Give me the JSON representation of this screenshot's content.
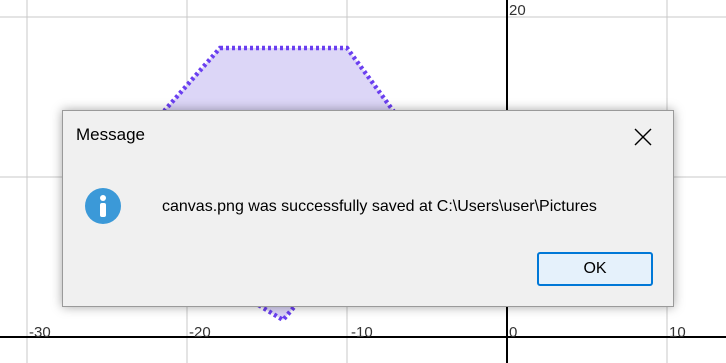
{
  "canvas": {
    "x_labels": [
      "-30",
      "-20",
      "-10",
      "0",
      "10"
    ],
    "y_labels": [
      "20"
    ],
    "polygon_fill": "#dcd6f7",
    "polygon_stroke": "#6a3ff0"
  },
  "dialog": {
    "title": "Message",
    "message": "canvas.png was successfully saved at C:\\Users\\user\\Pictures",
    "ok_label": "OK",
    "icon": "info-icon",
    "accent_color": "#0078d7"
  }
}
